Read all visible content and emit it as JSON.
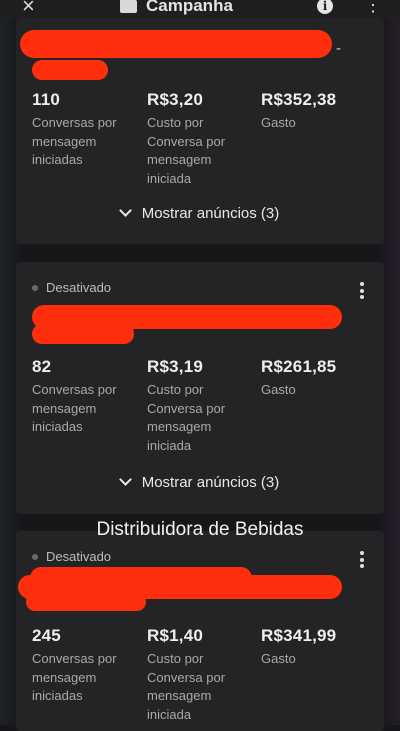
{
  "header": {
    "close_icon": "close-icon",
    "folder_icon": "folder-icon",
    "title": "Campanha",
    "info_icon": "info-icon",
    "more_icon": "more-vert-icon"
  },
  "overlay_caption": "Distribuidora de Bebidas",
  "colors": {
    "redaction": "#ff2e0c",
    "card_bg": "#242427",
    "page_bg": "#17171a"
  },
  "cards": [
    {
      "status": "",
      "name_fragment": "-",
      "metrics": [
        {
          "value": "110",
          "label_lines": [
            "Conversas por",
            "mensagem",
            "iniciadas"
          ]
        },
        {
          "value": "R$3,20",
          "label_lines": [
            "Custo por",
            "Conversa por",
            "mensagem",
            "iniciada"
          ]
        },
        {
          "value": "R$352,38",
          "label_lines": [
            "Gasto"
          ]
        }
      ],
      "show_ads": "Mostrar anúncios (3)"
    },
    {
      "status": "Desativado",
      "metrics": [
        {
          "value": "82",
          "label_lines": [
            "Conversas por",
            "mensagem",
            "iniciadas"
          ]
        },
        {
          "value": "R$3,19",
          "label_lines": [
            "Custo por",
            "Conversa por",
            "mensagem",
            "iniciada"
          ]
        },
        {
          "value": "R$261,85",
          "label_lines": [
            "Gasto"
          ]
        }
      ],
      "show_ads": "Mostrar anúncios (3)"
    },
    {
      "status": "Desativado",
      "metrics": [
        {
          "value": "245",
          "label_lines": [
            "Conversas por",
            "mensagem",
            "iniciadas"
          ]
        },
        {
          "value": "R$1,40",
          "label_lines": [
            "Custo por",
            "Conversa por",
            "mensagem",
            "iniciada"
          ]
        },
        {
          "value": "R$341,99",
          "label_lines": [
            "Gasto"
          ]
        }
      ]
    }
  ]
}
